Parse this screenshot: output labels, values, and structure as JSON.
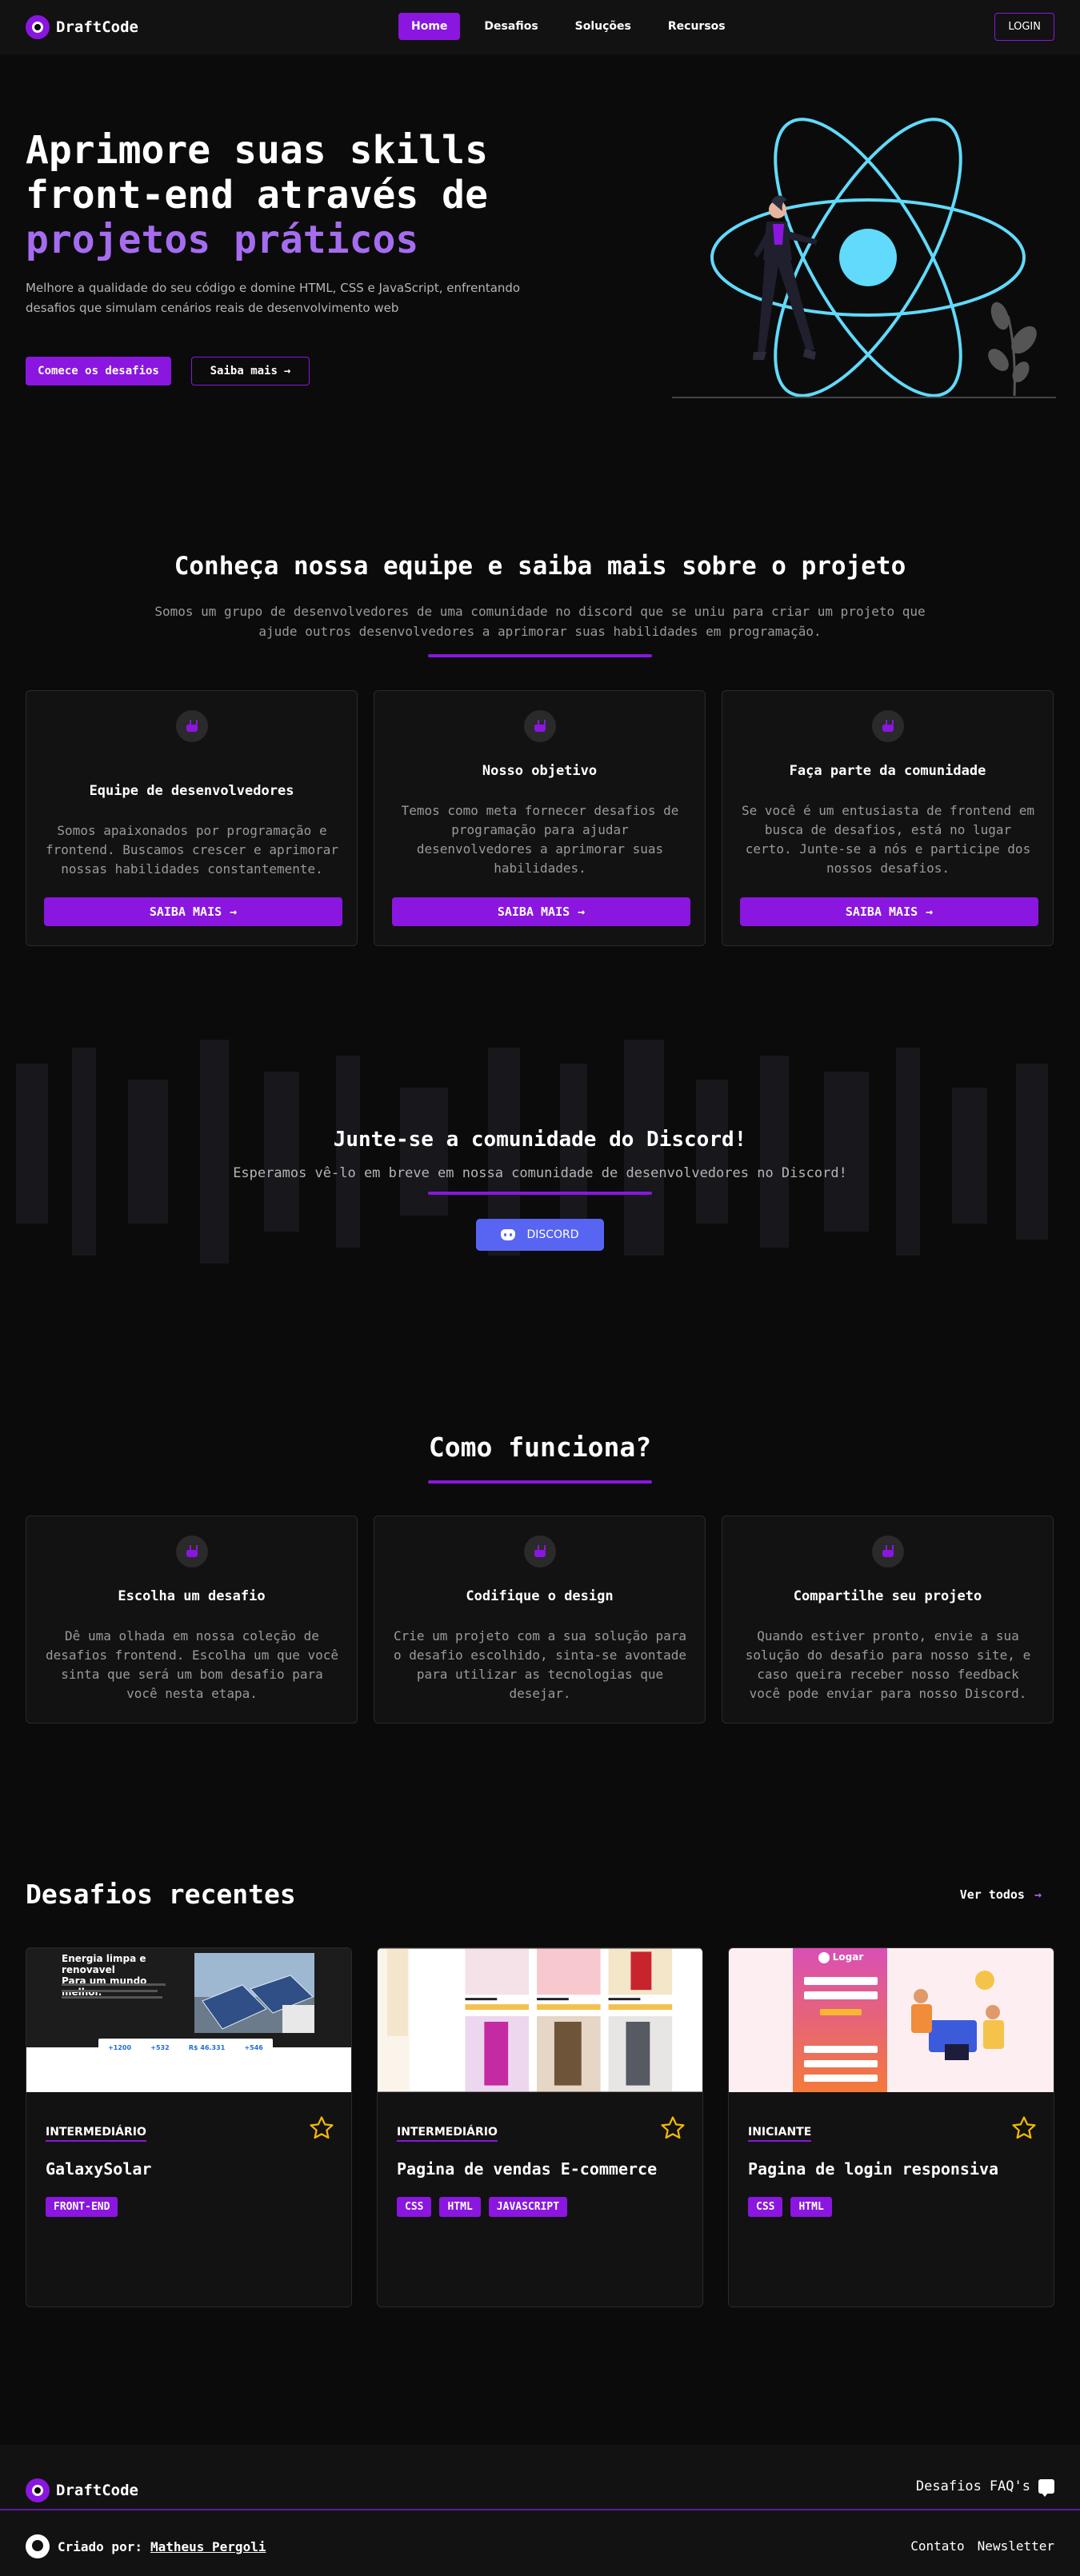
{
  "nav": {
    "brand": "DraftCode",
    "links": [
      "Home",
      "Desafios",
      "Soluções",
      "Recursos"
    ],
    "login": "LOGIN"
  },
  "hero": {
    "title_line1": "Aprimore suas skills",
    "title_line2": "front-end através de",
    "title_accent": "projetos práticos",
    "subtitle": "Melhore a qualidade do seu código e domine HTML, CSS e JavaScript, enfrentando desafios que simulam cenários reais de desenvolvimento web",
    "primary_button": "Comece os desafios",
    "secondary_button": "Saiba mais"
  },
  "team": {
    "title": "Conheça nossa equipe e saiba mais sobre o projeto",
    "description": "Somos um grupo de desenvolvedores de uma comunidade no discord que se uniu para criar um projeto que ajude outros desenvolvedores a aprimorar suas habilidades em programação.",
    "cards": [
      {
        "title": "Equipe de desenvolvedores",
        "text": "Somos apaixonados por programação e frontend. Buscamos crescer e aprimorar nossas habilidades constantemente.",
        "button": "SAIBA MAIS"
      },
      {
        "title": "Nosso objetivo",
        "text": "Temos como meta fornecer desafios de programação para ajudar desenvolvedores a aprimorar suas habilidades.",
        "button": "SAIBA MAIS"
      },
      {
        "title": "Faça parte da comunidade",
        "text": "Se você é um entusiasta de frontend em busca de desafios, está no lugar certo. Junte-se a nós e participe dos nossos desafios.",
        "button": "SAIBA MAIS"
      }
    ]
  },
  "discord": {
    "title": "Junte-se a comunidade do Discord!",
    "description": "Esperamos vê-lo em breve em nossa comunidade de desenvolvedores no Discord!",
    "button": "DISCORD",
    "brand_color": "#5865f2"
  },
  "how": {
    "title": "Como funciona?",
    "cards": [
      {
        "title": "Escolha um desafio",
        "text": "Dê uma olhada em nossa coleção de desafios frontend. Escolha um que você sinta que será um bom desafio para você nesta etapa."
      },
      {
        "title": "Codifique o design",
        "text": "Crie um projeto com a sua solução para o desafio escolhido, sinta-se avontade para utilizar as tecnologias que desejar."
      },
      {
        "title": "Compartilhe seu projeto",
        "text": "Quando estiver pronto, envie a sua solução do desafio para nosso site, e caso queira receber nosso feedback você pode enviar para nosso Discord."
      }
    ]
  },
  "recent": {
    "title": "Desafios recentes",
    "see_all": "Ver todos",
    "challenges": [
      {
        "level": "INTERMEDIÁRIO",
        "name": "GalaxySolar",
        "tags": [
          "FRONT-END"
        ],
        "thumb_heading": "Energia limpa e renovavel\nPara um mundo melhor.",
        "thumb_stats": [
          "+1200",
          "+532",
          "R$ 46.331",
          "+546"
        ]
      },
      {
        "level": "INTERMEDIÁRIO",
        "name": "Pagina de vendas E-commerce",
        "tags": [
          "CSS",
          "HTML",
          "JAVASCRIPT"
        ]
      },
      {
        "level": "INICIANTE",
        "name": "Pagina de login responsiva",
        "tags": [
          "CSS",
          "HTML"
        ],
        "thumb_heading": "Logar"
      }
    ]
  },
  "footer": {
    "brand": "DraftCode",
    "links": [
      "Desafios",
      "FAQ's"
    ],
    "credit_label": "Criado por:",
    "credit_name": "Matheus Pergoli",
    "bottom_links": [
      "Contato",
      "Newsletter"
    ]
  },
  "colors": {
    "accent": "#8a16e0",
    "accent_light": "#a56cf0",
    "background": "#0b0b0b",
    "card": "#121212"
  }
}
